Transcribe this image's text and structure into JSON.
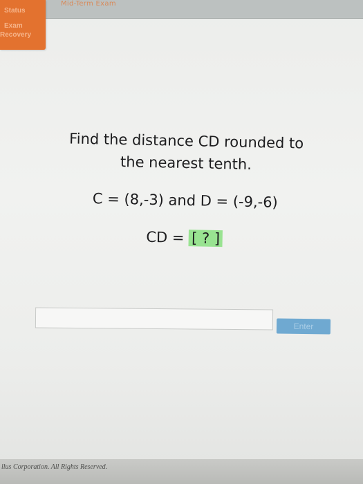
{
  "header": {
    "title": "Mid-Term Exam"
  },
  "sidebar": {
    "line1": "Status",
    "line2": "Exam",
    "line3": "Recovery"
  },
  "question": {
    "line1": "Find the distance CD rounded to",
    "line2": "the nearest tenth.",
    "coordinates": "C = (8,-3) and D = (-9,-6)",
    "answer_prefix": "CD = ",
    "answer_box": "[ ? ]"
  },
  "answer_input": {
    "value": "",
    "placeholder": ""
  },
  "enter_button": {
    "label": "Enter"
  },
  "footer": {
    "text": "llus Corporation. All Rights Reserved."
  },
  "colors": {
    "accent_orange": "#e3722f",
    "answer_highlight": "#99e391",
    "enter_button": "#6fa9d1"
  }
}
